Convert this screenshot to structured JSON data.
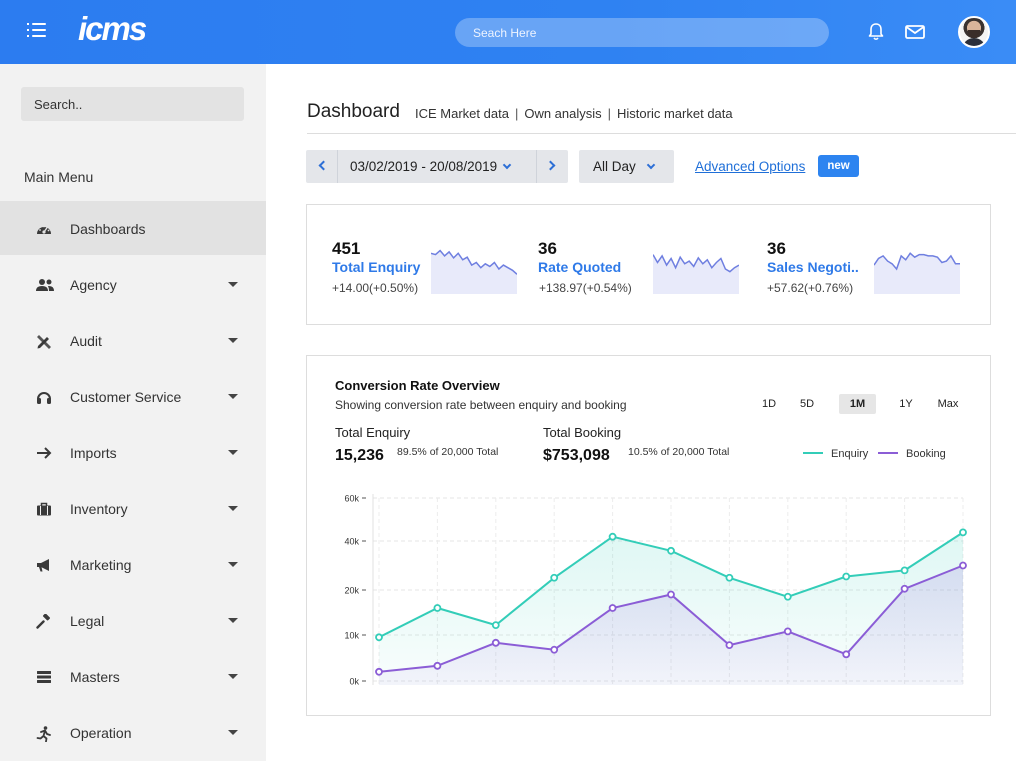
{
  "app": {
    "logo": "icms"
  },
  "topbar": {
    "search_placeholder": "Seach Here"
  },
  "sidebar": {
    "search_placeholder": "Search..",
    "menu_title": "Main Menu",
    "items": [
      {
        "label": "Dashboards",
        "icon": "gauge-icon",
        "active": true
      },
      {
        "label": "Agency",
        "icon": "users-icon"
      },
      {
        "label": "Audit",
        "icon": "pencil-ruler-icon"
      },
      {
        "label": "Customer Service",
        "icon": "headset-icon"
      },
      {
        "label": "Imports",
        "icon": "arrow-right-icon"
      },
      {
        "label": "Inventory",
        "icon": "briefcase-icon"
      },
      {
        "label": "Marketing",
        "icon": "megaphone-icon"
      },
      {
        "label": "Legal",
        "icon": "gavel-icon"
      },
      {
        "label": "Masters",
        "icon": "stack-icon"
      },
      {
        "label": "Operation",
        "icon": "running-icon"
      }
    ]
  },
  "header": {
    "title": "Dashboard",
    "links": [
      "ICE Market data",
      "Own analysis",
      "Historic market data"
    ]
  },
  "filters": {
    "date_range": "03/02/2019 - 20/08/2019",
    "period": "All Day",
    "advanced": "Advanced Options",
    "badge": "new"
  },
  "kpis": [
    {
      "value": "451",
      "label": "Total Enquiry",
      "change": "+14.00(+0.50%)",
      "spark": [
        62,
        60,
        66,
        58,
        64,
        55,
        62,
        52,
        56,
        44,
        48,
        40,
        46,
        42,
        48,
        38,
        44,
        40,
        36,
        30
      ]
    },
    {
      "value": "36",
      "label": "Rate Quoted",
      "change": "+138.97(+0.54%)",
      "spark": [
        60,
        48,
        58,
        44,
        54,
        40,
        56,
        46,
        50,
        42,
        55,
        46,
        52,
        40,
        48,
        54,
        38,
        34,
        40,
        44
      ]
    },
    {
      "value": "36",
      "label": "Sales Negoti..",
      "change": "+57.62(+0.76%)",
      "spark": [
        44,
        54,
        58,
        50,
        46,
        38,
        58,
        52,
        62,
        56,
        60,
        60,
        58,
        58,
        56,
        48,
        50,
        58,
        46,
        46
      ]
    }
  ],
  "conversion": {
    "title": "Conversion Rate Overview",
    "subtitle": "Showing conversion rate between enquiry and booking",
    "periods": [
      "1D",
      "5D",
      "1M",
      "1Y",
      "Max"
    ],
    "active_period": "1M",
    "total_enquiry_label": "Total Enquiry",
    "total_enquiry_value": "15,236",
    "total_enquiry_note": "89.5% of 20,000 Total",
    "total_booking_label": "Total Booking",
    "total_booking_value": "$753,098",
    "total_booking_note": "10.5% of 20,000 Total",
    "legend": [
      "Enquiry",
      "Booking"
    ]
  },
  "colors": {
    "enquiry": "#33cdb8",
    "booking": "#8b5dd6",
    "accent": "#2f7ae8",
    "topbar": "#2f82f2"
  },
  "chart_data": {
    "type": "area",
    "ylabel_ticks": [
      "0k",
      "10k",
      "20k",
      "40k",
      "60k"
    ],
    "tick_values": [
      0,
      10,
      20,
      40,
      60
    ],
    "series": [
      {
        "name": "Enquiry",
        "values": [
          9.5,
          16,
          12.2,
          25,
          42,
          36,
          25,
          18.5,
          25.5,
          28,
          44
        ]
      },
      {
        "name": "Booking",
        "values": [
          2,
          3.3,
          8.3,
          6.8,
          16,
          19,
          7.8,
          10.8,
          5.8,
          20.5,
          30
        ]
      }
    ],
    "ylim": [
      0,
      60
    ]
  }
}
